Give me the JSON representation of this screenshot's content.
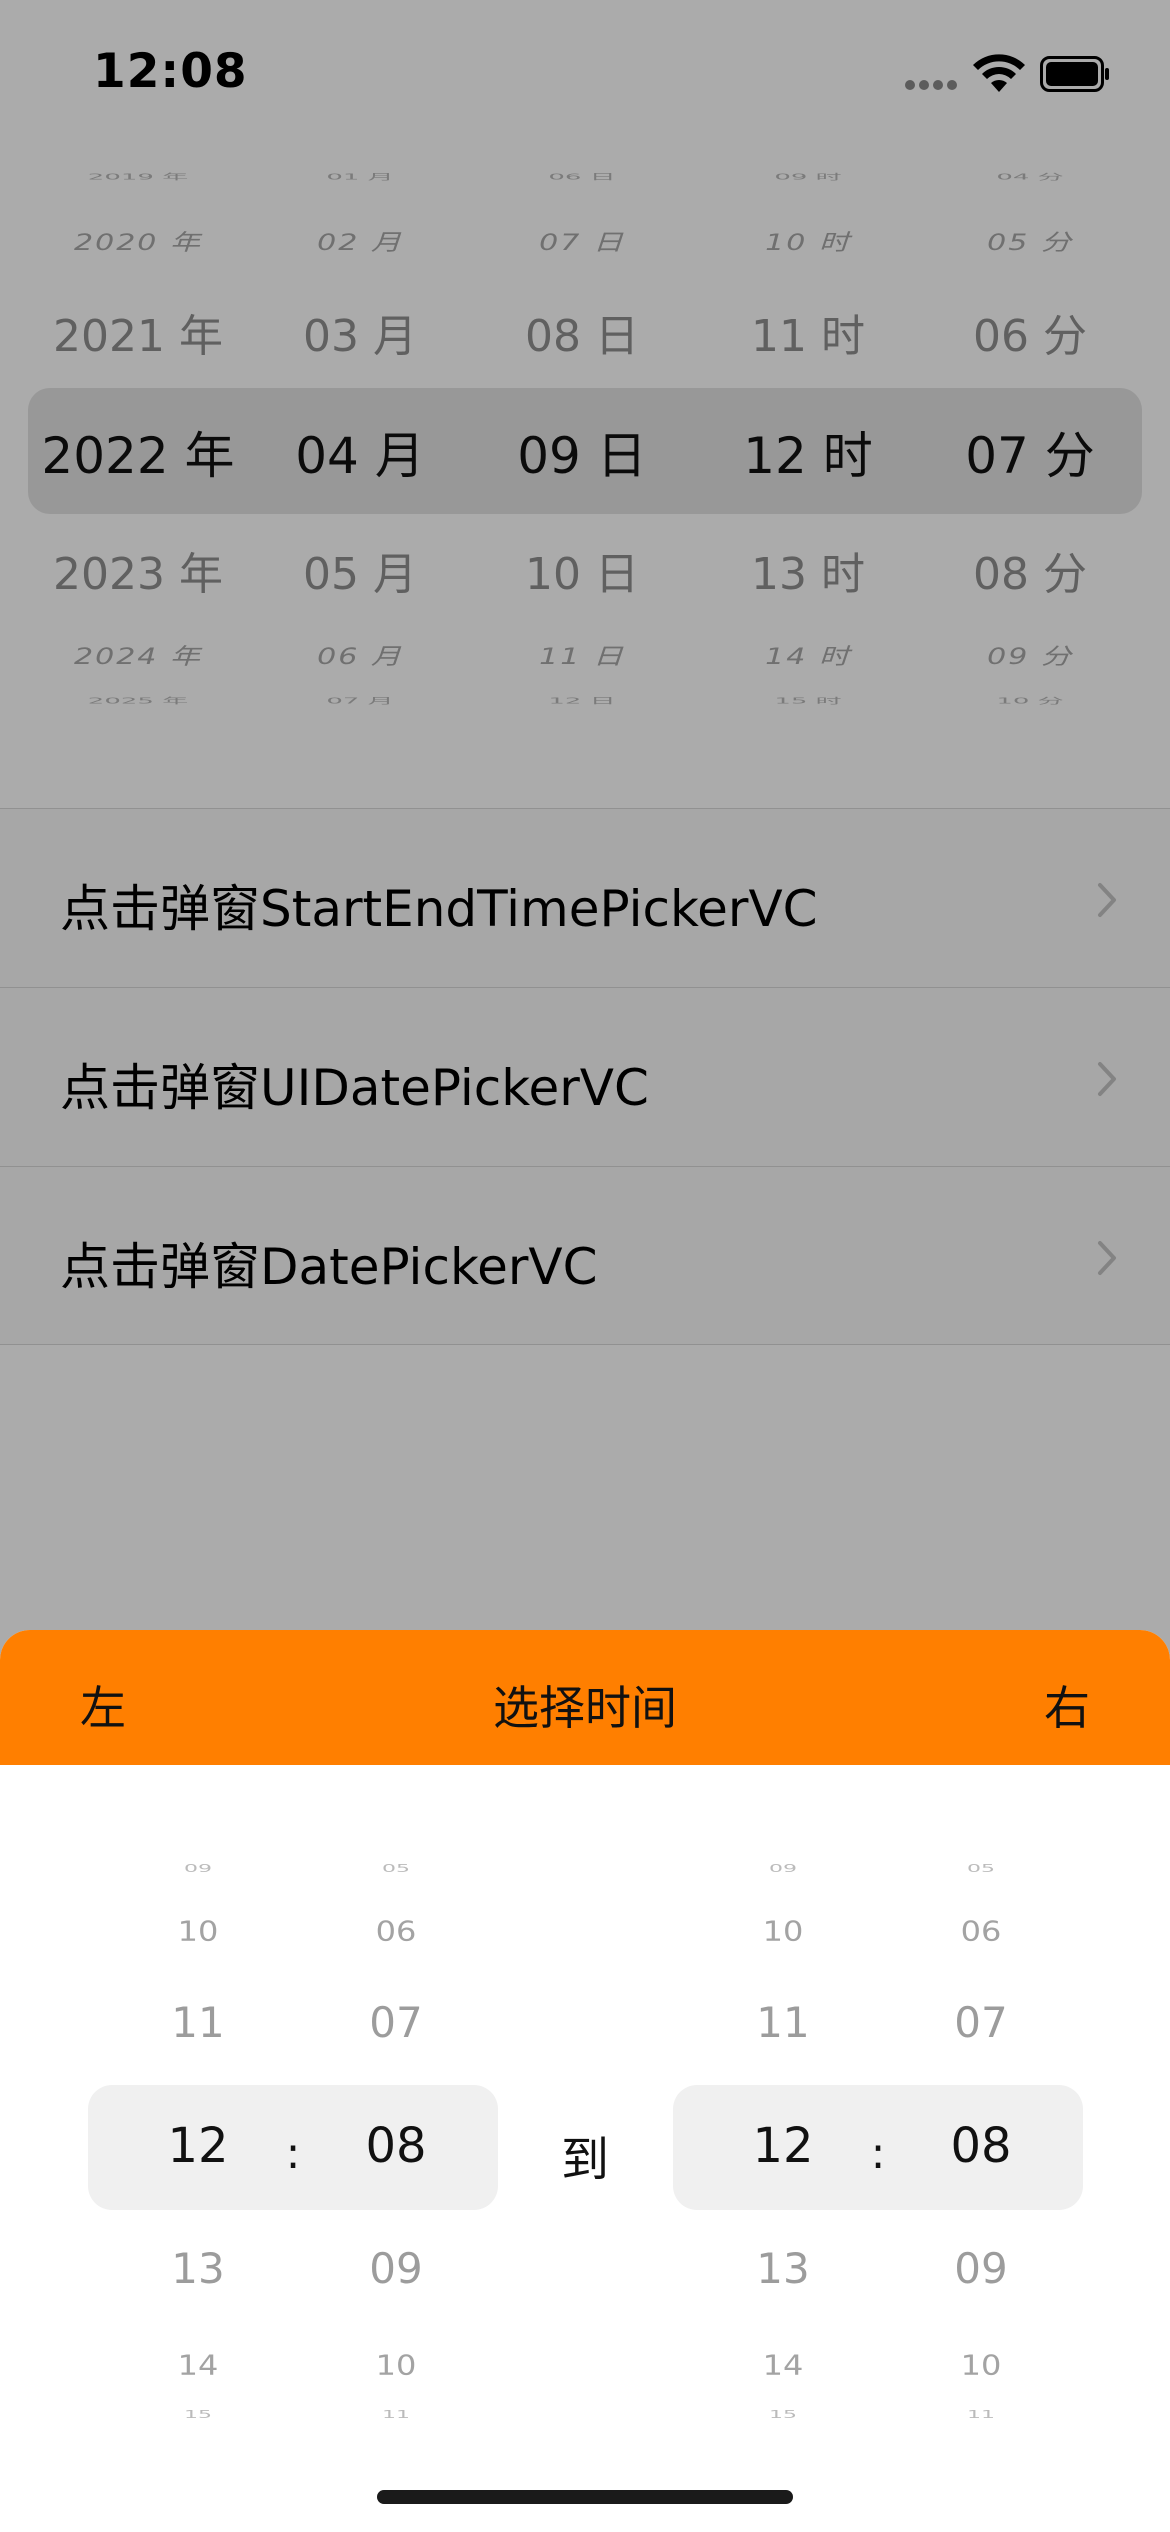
{
  "status_bar": {
    "time": "12:08"
  },
  "top_picker": {
    "columns": [
      {
        "ghost_top": "2019 年",
        "edge_top": "2020 年",
        "near_top": "2021 年",
        "selected": "2022 年",
        "near_bottom": "2023 年",
        "edge_bottom": "2024 年",
        "ghost_bottom": "2025 年"
      },
      {
        "ghost_top": "01 月",
        "edge_top": "02 月",
        "near_top": "03 月",
        "selected": "04 月",
        "near_bottom": "05 月",
        "edge_bottom": "06 月",
        "ghost_bottom": "07 月"
      },
      {
        "ghost_top": "06 日",
        "edge_top": "07 日",
        "near_top": "08 日",
        "selected": "09 日",
        "near_bottom": "10 日",
        "edge_bottom": "11 日",
        "ghost_bottom": "12 日"
      },
      {
        "ghost_top": "09 时",
        "edge_top": "10 时",
        "near_top": "11 时",
        "selected": "12 时",
        "near_bottom": "13 时",
        "edge_bottom": "14 时",
        "ghost_bottom": "15 时"
      },
      {
        "ghost_top": "04 分",
        "edge_top": "05 分",
        "near_top": "06 分",
        "selected": "07 分",
        "near_bottom": "08 分",
        "edge_bottom": "09 分",
        "ghost_bottom": "10 分"
      }
    ]
  },
  "list": {
    "items": [
      {
        "label": "点击弹窗StartEndTimePickerVC"
      },
      {
        "label": "点击弹窗UIDatePickerVC"
      },
      {
        "label": "点击弹窗DatePickerVC"
      }
    ]
  },
  "sheet": {
    "header": {
      "left": "左",
      "title": "选择时间",
      "right": "右",
      "color": "#ff7f00"
    },
    "separator": ":",
    "to_label": "到",
    "start": {
      "hour": {
        "ghost_top": "09",
        "far_top": "10",
        "near_top": "11",
        "selected": "12",
        "near_bottom": "13",
        "far_bottom": "14",
        "ghost_bottom": "15"
      },
      "minute": {
        "ghost_top": "05",
        "far_top": "06",
        "near_top": "07",
        "selected": "08",
        "near_bottom": "09",
        "far_bottom": "10",
        "ghost_bottom": "11"
      }
    },
    "end": {
      "hour": {
        "ghost_top": "09",
        "far_top": "10",
        "near_top": "11",
        "selected": "12",
        "near_bottom": "13",
        "far_bottom": "14",
        "ghost_bottom": "15"
      },
      "minute": {
        "ghost_top": "05",
        "far_top": "06",
        "near_top": "07",
        "selected": "08",
        "near_bottom": "09",
        "far_bottom": "10",
        "ghost_bottom": "11"
      }
    }
  }
}
